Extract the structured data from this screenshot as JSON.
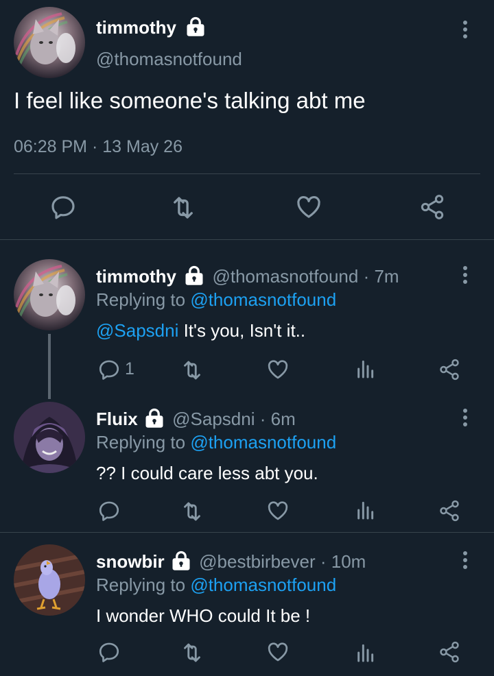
{
  "main_tweet": {
    "name": "timmothy",
    "handle": "@thomasnotfound",
    "text": "I feel like someone's talking abt me",
    "time": "06:28 PM",
    "separator": "·",
    "date": "13 May 26"
  },
  "replies": [
    {
      "name": "timmothy",
      "handle": "@thomasnotfound",
      "time": "· 7m",
      "replying_prefix": "Replying to",
      "replying_to": "@thomasnotfound",
      "mention": "@Sapsdni",
      "text": " It's you, Isn't it..",
      "reply_count": "1"
    },
    {
      "name": "Fluix",
      "handle": "@Sapsdni",
      "time": "· 6m",
      "replying_prefix": "Replying to",
      "replying_to": "@thomasnotfound",
      "text": "?? I could care less abt you."
    },
    {
      "name": "snowbir",
      "handle": "@bestbirbever",
      "time": "· 10m",
      "replying_prefix": "Replying to",
      "replying_to": "@thomasnotfound",
      "text": "I wonder WHO could It be !"
    }
  ],
  "colors": {
    "background": "#15202b",
    "text": "#ffffff",
    "muted": "#8899a6",
    "accent": "#1da1f2",
    "divider": "#38444d"
  },
  "icons": [
    "lock-icon",
    "more-icon",
    "reply-icon",
    "retweet-icon",
    "like-icon",
    "share-icon",
    "analytics-icon"
  ]
}
